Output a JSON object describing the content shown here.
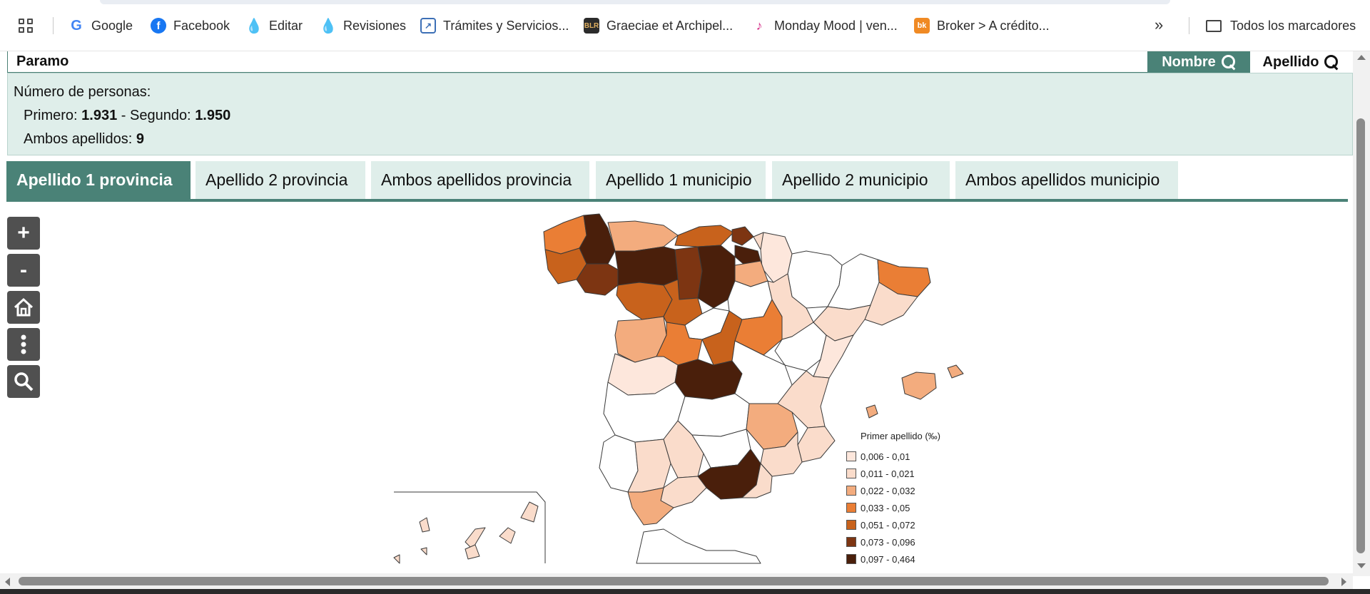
{
  "bookmarks": {
    "items": [
      {
        "label": "Google",
        "icon": "google-icon",
        "color": "#4285F4"
      },
      {
        "label": "Facebook",
        "icon": "facebook-icon",
        "color": "#1877F2"
      },
      {
        "label": "Editar",
        "icon": "drupal-icon",
        "color": "#0678BE"
      },
      {
        "label": "Revisiones",
        "icon": "drupal-icon",
        "color": "#0678BE"
      },
      {
        "label": "Trámites y Servicios...",
        "icon": "document-icon",
        "color": "#3c6fb6"
      },
      {
        "label": "Graeciae et Archipel...",
        "icon": "blr-icon",
        "color": "#2b2b2b"
      },
      {
        "label": "Monday Mood | ven...",
        "icon": "monday-mood-icon",
        "color": "#d6338a"
      },
      {
        "label": "Broker > A crédito...",
        "icon": "bk-icon",
        "color": "#f08a24"
      }
    ],
    "all_bookmarks_label": "Todos los marcadores"
  },
  "search": {
    "value": "Paramo",
    "nombre_label": "Nombre",
    "apellido_label": "Apellido"
  },
  "info": {
    "heading": "Número de personas:",
    "primero_label": "Primero:",
    "primero_value": "1.931",
    "segundo_label": "- Segundo:",
    "segundo_value": "1.950",
    "ambos_label": "Ambos apellidos:",
    "ambos_value": "9"
  },
  "tabs": [
    {
      "label": "Apellido 1 provincia",
      "active": true
    },
    {
      "label": "Apellido 2 provincia",
      "active": false
    },
    {
      "label": "Ambos apellidos provincia",
      "active": false
    },
    {
      "label": "Apellido 1 municipio",
      "active": false
    },
    {
      "label": "Apellido 2 municipio",
      "active": false
    },
    {
      "label": "Ambos apellidos municipio",
      "active": false
    }
  ],
  "map_controls": [
    {
      "label": "+",
      "icon": "zoom-in-icon"
    },
    {
      "label": "-",
      "icon": "zoom-out-icon"
    },
    {
      "label": "",
      "icon": "home-icon"
    },
    {
      "label": "",
      "icon": "more-icon"
    },
    {
      "label": "",
      "icon": "search-icon"
    }
  ],
  "legend": {
    "title": "Primer apellido (‰)",
    "items": [
      {
        "label": "0,006 - 0,01",
        "color": "#fde7dc"
      },
      {
        "label": "0,011 - 0,021",
        "color": "#fadccb"
      },
      {
        "label": "0,022 - 0,032",
        "color": "#f3ac7e"
      },
      {
        "label": "0,033 - 0,05",
        "color": "#ea7e35"
      },
      {
        "label": "0,051 - 0,072",
        "color": "#c8621c"
      },
      {
        "label": "0,073 - 0,096",
        "color": "#7d3512"
      },
      {
        "label": "0,097 - 0,464",
        "color": "#4a1f0b"
      }
    ]
  },
  "colors": {
    "accent": "#4a8277",
    "info_bg": "#dfeeea",
    "no_data": "#ffffff"
  }
}
